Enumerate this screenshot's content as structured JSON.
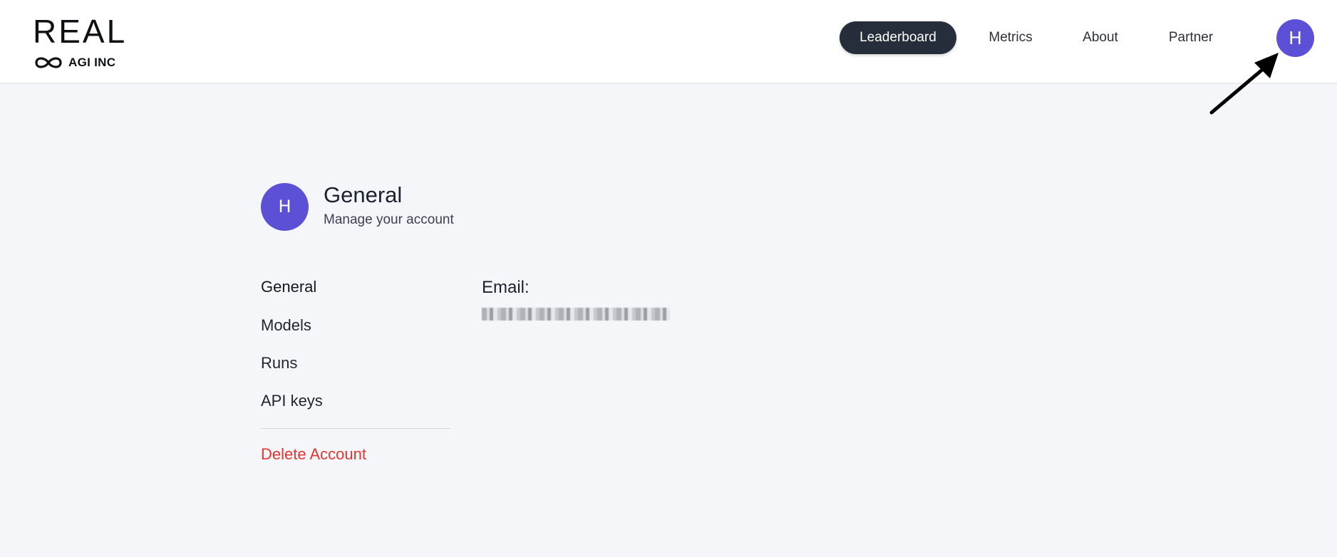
{
  "brand": {
    "name": "REAL",
    "company": "AGI INC",
    "logo_icon": "infinity-icon"
  },
  "nav": {
    "items": [
      {
        "label": "Leaderboard",
        "active": true
      },
      {
        "label": "Metrics",
        "active": false
      },
      {
        "label": "About",
        "active": false
      },
      {
        "label": "Partner",
        "active": false
      }
    ],
    "avatar_initial": "H"
  },
  "profile": {
    "avatar_initial": "H",
    "title": "General",
    "subtitle": "Manage your account"
  },
  "sidebar": {
    "items": [
      {
        "label": "General",
        "current": true
      },
      {
        "label": "Models",
        "current": false
      },
      {
        "label": "Runs",
        "current": false
      },
      {
        "label": "API keys",
        "current": false
      }
    ],
    "delete_label": "Delete Account"
  },
  "account": {
    "email_label": "Email:"
  },
  "colors": {
    "accent_avatar": "#5b50d6",
    "active_nav": "#262d3b",
    "danger": "#e0382e",
    "background": "#f5f6fa"
  }
}
